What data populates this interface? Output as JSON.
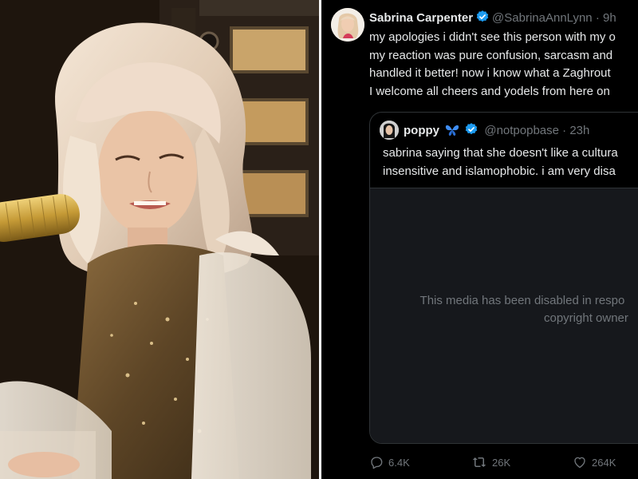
{
  "tweet": {
    "display_name": "Sabrina Carpenter",
    "verified_icon": "verified-badge-icon",
    "handle": "@SabrinaAnnLynn",
    "separator": "·",
    "time": "9h",
    "lines": [
      "my apologies i didn't see this person with my o",
      "my reaction was pure confusion, sarcasm and",
      "handled it better! now i know what a Zaghrout",
      "I welcome all cheers and yodels from here on"
    ]
  },
  "quote": {
    "display_name": "poppy",
    "emoji_icon": "blue-butterfly-icon",
    "verified_icon": "verified-badge-icon",
    "handle": "@notpopbase",
    "separator": "·",
    "time": "23h",
    "lines": [
      "sabrina saying that she doesn't like a cultura",
      "insensitive and islamophobic. i am very disa"
    ],
    "media_notice_line1": "This media has been disabled in respo",
    "media_notice_line2": "copyright owner"
  },
  "actions": {
    "replies": "6.4K",
    "retweets": "26K",
    "likes": "264K"
  },
  "colors": {
    "background": "#000000",
    "text_primary": "#e7e9ea",
    "text_secondary": "#71767b",
    "verified_blue": "#1d9bf0",
    "border": "#2f3336"
  }
}
